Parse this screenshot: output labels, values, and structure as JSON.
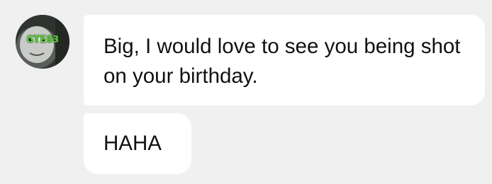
{
  "sender": {
    "avatar_label": "GTE03",
    "avatar_colors": {
      "background": "#3a3f3b",
      "face": "#c9cbc8",
      "label": "#5fcf3a"
    }
  },
  "messages": [
    {
      "text": "Big, I would love to see you being shot on your birthday."
    },
    {
      "text": "HAHA"
    }
  ],
  "colors": {
    "page_background": "#f0f0f0",
    "bubble_background": "#ffffff",
    "text": "#111111"
  }
}
